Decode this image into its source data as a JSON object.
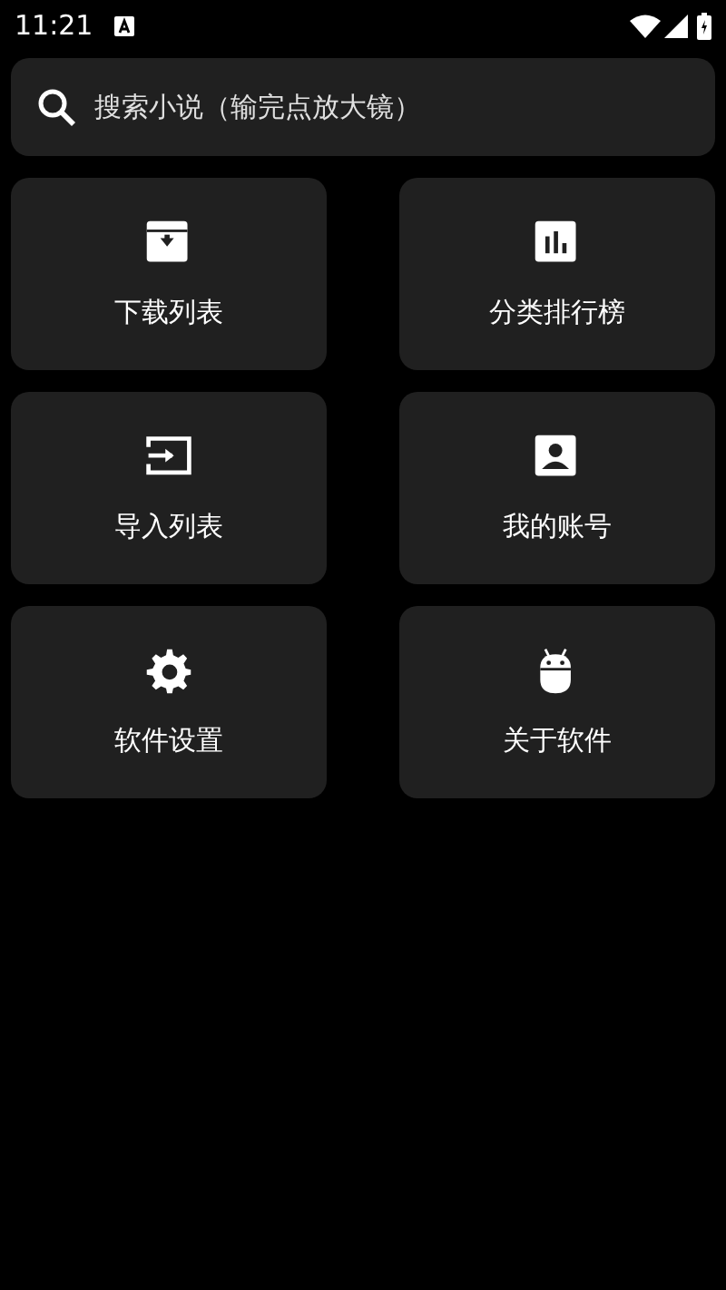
{
  "status_bar": {
    "time": "11:21"
  },
  "search": {
    "placeholder": "搜索小说（输完点放大镜）"
  },
  "menu": [
    {
      "kind": "download",
      "label": "下载列表"
    },
    {
      "kind": "chart",
      "label": "分类排行榜"
    },
    {
      "kind": "import",
      "label": "导入列表"
    },
    {
      "kind": "account",
      "label": "我的账号"
    },
    {
      "kind": "settings",
      "label": "软件设置"
    },
    {
      "kind": "about",
      "label": "关于软件"
    }
  ]
}
